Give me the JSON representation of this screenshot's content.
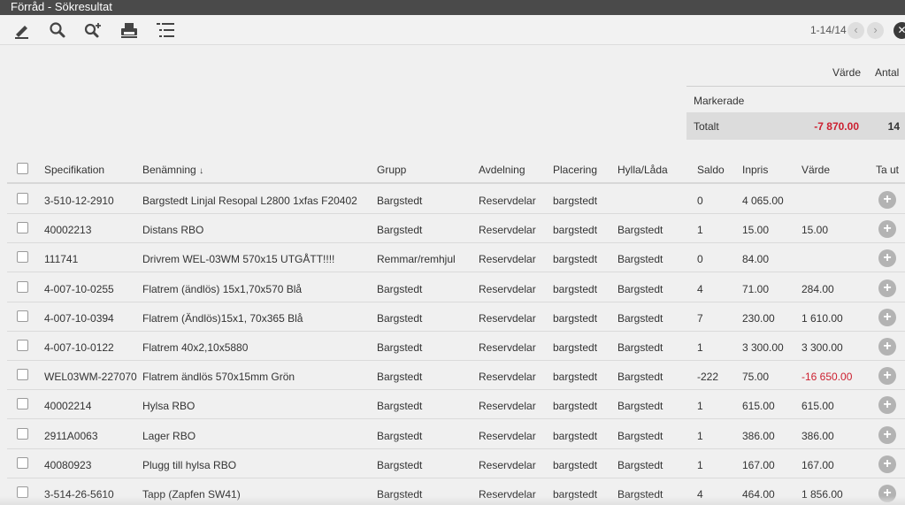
{
  "window": {
    "title": "Förråd - Sökresultat"
  },
  "toolbar": {
    "tools": [
      {
        "icon": "pencil-icon"
      },
      {
        "icon": "search-icon"
      },
      {
        "icon": "search-plus-icon"
      },
      {
        "icon": "printer-icon"
      },
      {
        "icon": "list-icon"
      }
    ],
    "pager_text": "1-14/14",
    "prev": "‹",
    "next": "›",
    "close": "✕"
  },
  "summary": {
    "col_value": "Värde",
    "col_count": "Antal",
    "selected_label": "Markerade",
    "selected_value": "",
    "selected_count": "",
    "total_label": "Totalt",
    "total_value": "-7 870.00",
    "total_count": "14",
    "negative_color": "#cc1f2f"
  },
  "table": {
    "columns": {
      "spec": "Specifikation",
      "name": "Benämning",
      "sort_indicator": "↓",
      "group": "Grupp",
      "dept": "Avdelning",
      "place": "Placering",
      "shelf": "Hylla/Låda",
      "balance": "Saldo",
      "price": "Inpris",
      "value": "Värde",
      "take": "Ta ut"
    },
    "rows": [
      {
        "spec": "3-510-12-2910",
        "name": "Bargstedt Linjal Resopal L2800 1xfas F20402",
        "group": "Bargstedt",
        "dept": "Reservdelar",
        "place": "bargstedt",
        "shelf": "",
        "balance": "0",
        "price": "4 065.00",
        "value": ""
      },
      {
        "spec": "40002213",
        "name": "Distans RBO",
        "group": "Bargstedt",
        "dept": "Reservdelar",
        "place": "bargstedt",
        "shelf": "Bargstedt",
        "balance": "1",
        "price": "15.00",
        "value": "15.00"
      },
      {
        "spec": "111741",
        "name": "Drivrem WEL-03WM 570x15 UTGÅTT!!!!",
        "group": "Remmar/remhjul",
        "dept": "Reservdelar",
        "place": "bargstedt",
        "shelf": "Bargstedt",
        "balance": "0",
        "price": "84.00",
        "value": ""
      },
      {
        "spec": "4-007-10-0255",
        "name": "Flatrem (ändlös) 15x1,70x570 Blå",
        "group": "Bargstedt",
        "dept": "Reservdelar",
        "place": "bargstedt",
        "shelf": "Bargstedt",
        "balance": "4",
        "price": "71.00",
        "value": "284.00"
      },
      {
        "spec": "4-007-10-0394",
        "name": "Flatrem (Ändlös)15x1, 70x365 Blå",
        "group": "Bargstedt",
        "dept": "Reservdelar",
        "place": "bargstedt",
        "shelf": "Bargstedt",
        "balance": "7",
        "price": "230.00",
        "value": "1 610.00"
      },
      {
        "spec": "4-007-10-0122",
        "name": "Flatrem 40x2,10x5880",
        "group": "Bargstedt",
        "dept": "Reservdelar",
        "place": "bargstedt",
        "shelf": "Bargstedt",
        "balance": "1",
        "price": "3 300.00",
        "value": "3 300.00"
      },
      {
        "spec": "WEL03WM-227070",
        "name": "Flatrem ändlös 570x15mm Grön",
        "group": "Bargstedt",
        "dept": "Reservdelar",
        "place": "bargstedt",
        "shelf": "Bargstedt",
        "balance": "-222",
        "price": "75.00",
        "value": "-16 650.00",
        "negative": true
      },
      {
        "spec": "40002214",
        "name": "Hylsa RBO",
        "group": "Bargstedt",
        "dept": "Reservdelar",
        "place": "bargstedt",
        "shelf": "Bargstedt",
        "balance": "1",
        "price": "615.00",
        "value": "615.00"
      },
      {
        "spec": "2911A0063",
        "name": "Lager RBO",
        "group": "Bargstedt",
        "dept": "Reservdelar",
        "place": "bargstedt",
        "shelf": "Bargstedt",
        "balance": "1",
        "price": "386.00",
        "value": "386.00"
      },
      {
        "spec": "40080923",
        "name": "Plugg till hylsa RBO",
        "group": "Bargstedt",
        "dept": "Reservdelar",
        "place": "bargstedt",
        "shelf": "Bargstedt",
        "balance": "1",
        "price": "167.00",
        "value": "167.00"
      },
      {
        "spec": "3-514-26-5610",
        "name": "Tapp (Zapfen SW41)",
        "group": "Bargstedt",
        "dept": "Reservdelar",
        "place": "bargstedt",
        "shelf": "Bargstedt",
        "balance": "4",
        "price": "464.00",
        "value": "1 856.00"
      }
    ],
    "add_symbol": "+"
  }
}
